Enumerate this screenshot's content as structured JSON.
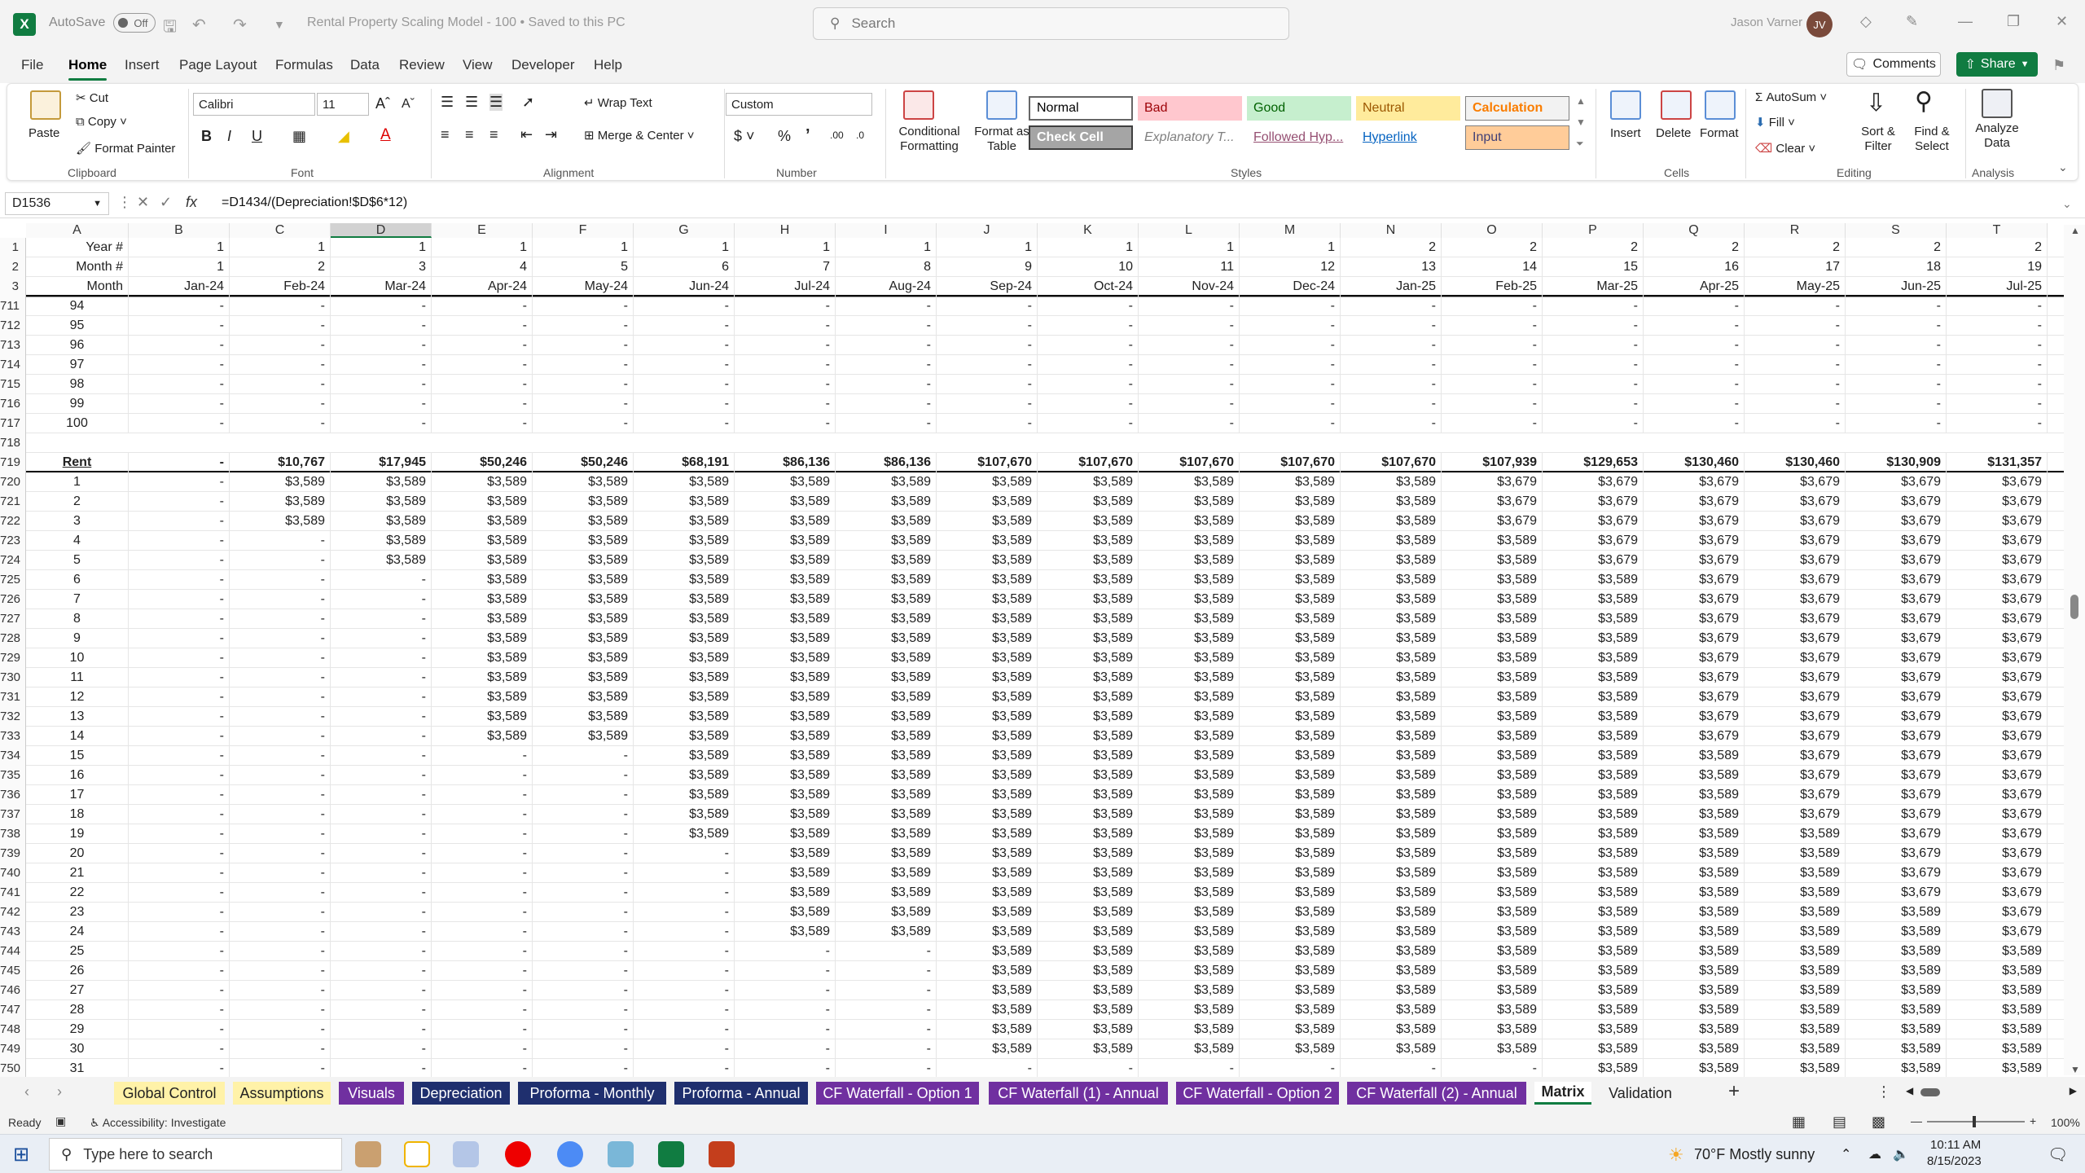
{
  "titlebar": {
    "autosave_label": "AutoSave",
    "autosave_state": "Off",
    "doc_title": "Rental Property Scaling Model - 100  •  Saved to this PC",
    "search_placeholder": "Search",
    "user_name": "Jason Varner",
    "user_initials": "JV"
  },
  "menu": [
    "File",
    "Home",
    "Insert",
    "Page Layout",
    "Formulas",
    "Data",
    "Review",
    "View",
    "Developer",
    "Help"
  ],
  "actions": {
    "comments": "Comments",
    "share": "Share"
  },
  "ribbon": {
    "clipboard": {
      "paste": "Paste",
      "cut": "Cut",
      "copy": "Copy",
      "format_painter": "Format Painter",
      "label": "Clipboard"
    },
    "font": {
      "name": "Calibri",
      "size": "11",
      "label": "Font"
    },
    "alignment": {
      "wrap": "Wrap Text",
      "merge": "Merge & Center",
      "label": "Alignment"
    },
    "number": {
      "format": "Custom",
      "label": "Number"
    },
    "styles": {
      "conditional": "Conditional Formatting",
      "format_table": "Format as Table",
      "label": "Styles",
      "cells": [
        "Normal",
        "Bad",
        "Good",
        "Neutral",
        "Calculation",
        "Check Cell",
        "Explanatory T...",
        "Followed Hyp...",
        "Hyperlink",
        "Input"
      ]
    },
    "cells": {
      "insert": "Insert",
      "delete": "Delete",
      "format": "Format",
      "label": "Cells"
    },
    "editing": {
      "autosum": "AutoSum",
      "fill": "Fill",
      "clear": "Clear",
      "sort": "Sort & Filter",
      "find": "Find & Select",
      "label": "Editing"
    },
    "analysis": {
      "analyze": "Analyze Data",
      "label": "Analysis"
    }
  },
  "formula_bar": {
    "name_box": "D1536",
    "formula": "=D1434/(Depreciation!$D$6*12)"
  },
  "columns": [
    "A",
    "B",
    "C",
    "D",
    "E",
    "F",
    "G",
    "H",
    "I",
    "J",
    "K",
    "L",
    "M",
    "N",
    "O",
    "P",
    "Q",
    "R",
    "S",
    "T"
  ],
  "header_rows": [
    {
      "num": "1",
      "cells": [
        "Year #",
        "1",
        "1",
        "1",
        "1",
        "1",
        "1",
        "1",
        "1",
        "1",
        "1",
        "1",
        "1",
        "2",
        "2",
        "2",
        "2",
        "2",
        "2",
        "2"
      ]
    },
    {
      "num": "2",
      "cells": [
        "Month #",
        "1",
        "2",
        "3",
        "4",
        "5",
        "6",
        "7",
        "8",
        "9",
        "10",
        "11",
        "12",
        "13",
        "14",
        "15",
        "16",
        "17",
        "18",
        "19"
      ]
    },
    {
      "num": "3",
      "cells": [
        "Month",
        "Jan-24",
        "Feb-24",
        "Mar-24",
        "Apr-24",
        "May-24",
        "Jun-24",
        "Jul-24",
        "Aug-24",
        "Sep-24",
        "Oct-24",
        "Nov-24",
        "Dec-24",
        "Jan-25",
        "Feb-25",
        "Mar-25",
        "Apr-25",
        "May-25",
        "Jun-25",
        "Jul-25"
      ]
    }
  ],
  "dash_rows": [
    {
      "num": "711",
      "a": "94"
    },
    {
      "num": "712",
      "a": "95"
    },
    {
      "num": "713",
      "a": "96"
    },
    {
      "num": "714",
      "a": "97"
    },
    {
      "num": "715",
      "a": "98"
    },
    {
      "num": "716",
      "a": "99"
    },
    {
      "num": "717",
      "a": "100"
    }
  ],
  "blank_row": "718",
  "rent_row": {
    "num": "719",
    "cells": [
      "Rent",
      "-",
      "$10,767",
      "$17,945",
      "$50,246",
      "$50,246",
      "$68,191",
      "$86,136",
      "$86,136",
      "$107,670",
      "$107,670",
      "$107,670",
      "$107,670",
      "$107,670",
      "$107,939",
      "$129,653",
      "$130,460",
      "$130,460",
      "$130,909",
      "$131,357"
    ]
  },
  "unit_rows": [
    {
      "num": "720",
      "cells": [
        "1",
        "-",
        "$3,589",
        "$3,589",
        "$3,589",
        "$3,589",
        "$3,589",
        "$3,589",
        "$3,589",
        "$3,589",
        "$3,589",
        "$3,589",
        "$3,589",
        "$3,589",
        "$3,679",
        "$3,679",
        "$3,679",
        "$3,679",
        "$3,679",
        "$3,679"
      ]
    },
    {
      "num": "721",
      "cells": [
        "2",
        "-",
        "$3,589",
        "$3,589",
        "$3,589",
        "$3,589",
        "$3,589",
        "$3,589",
        "$3,589",
        "$3,589",
        "$3,589",
        "$3,589",
        "$3,589",
        "$3,589",
        "$3,679",
        "$3,679",
        "$3,679",
        "$3,679",
        "$3,679",
        "$3,679"
      ]
    },
    {
      "num": "722",
      "cells": [
        "3",
        "-",
        "$3,589",
        "$3,589",
        "$3,589",
        "$3,589",
        "$3,589",
        "$3,589",
        "$3,589",
        "$3,589",
        "$3,589",
        "$3,589",
        "$3,589",
        "$3,589",
        "$3,679",
        "$3,679",
        "$3,679",
        "$3,679",
        "$3,679",
        "$3,679"
      ]
    },
    {
      "num": "723",
      "cells": [
        "4",
        "-",
        "-",
        "$3,589",
        "$3,589",
        "$3,589",
        "$3,589",
        "$3,589",
        "$3,589",
        "$3,589",
        "$3,589",
        "$3,589",
        "$3,589",
        "$3,589",
        "$3,589",
        "$3,679",
        "$3,679",
        "$3,679",
        "$3,679",
        "$3,679"
      ]
    },
    {
      "num": "724",
      "cells": [
        "5",
        "-",
        "-",
        "$3,589",
        "$3,589",
        "$3,589",
        "$3,589",
        "$3,589",
        "$3,589",
        "$3,589",
        "$3,589",
        "$3,589",
        "$3,589",
        "$3,589",
        "$3,589",
        "$3,679",
        "$3,679",
        "$3,679",
        "$3,679",
        "$3,679"
      ]
    },
    {
      "num": "725",
      "cells": [
        "6",
        "-",
        "-",
        "-",
        "$3,589",
        "$3,589",
        "$3,589",
        "$3,589",
        "$3,589",
        "$3,589",
        "$3,589",
        "$3,589",
        "$3,589",
        "$3,589",
        "$3,589",
        "$3,589",
        "$3,679",
        "$3,679",
        "$3,679",
        "$3,679"
      ]
    },
    {
      "num": "726",
      "cells": [
        "7",
        "-",
        "-",
        "-",
        "$3,589",
        "$3,589",
        "$3,589",
        "$3,589",
        "$3,589",
        "$3,589",
        "$3,589",
        "$3,589",
        "$3,589",
        "$3,589",
        "$3,589",
        "$3,589",
        "$3,679",
        "$3,679",
        "$3,679",
        "$3,679"
      ]
    },
    {
      "num": "727",
      "cells": [
        "8",
        "-",
        "-",
        "-",
        "$3,589",
        "$3,589",
        "$3,589",
        "$3,589",
        "$3,589",
        "$3,589",
        "$3,589",
        "$3,589",
        "$3,589",
        "$3,589",
        "$3,589",
        "$3,589",
        "$3,679",
        "$3,679",
        "$3,679",
        "$3,679"
      ]
    },
    {
      "num": "728",
      "cells": [
        "9",
        "-",
        "-",
        "-",
        "$3,589",
        "$3,589",
        "$3,589",
        "$3,589",
        "$3,589",
        "$3,589",
        "$3,589",
        "$3,589",
        "$3,589",
        "$3,589",
        "$3,589",
        "$3,589",
        "$3,679",
        "$3,679",
        "$3,679",
        "$3,679"
      ]
    },
    {
      "num": "729",
      "cells": [
        "10",
        "-",
        "-",
        "-",
        "$3,589",
        "$3,589",
        "$3,589",
        "$3,589",
        "$3,589",
        "$3,589",
        "$3,589",
        "$3,589",
        "$3,589",
        "$3,589",
        "$3,589",
        "$3,589",
        "$3,679",
        "$3,679",
        "$3,679",
        "$3,679"
      ]
    },
    {
      "num": "730",
      "cells": [
        "11",
        "-",
        "-",
        "-",
        "$3,589",
        "$3,589",
        "$3,589",
        "$3,589",
        "$3,589",
        "$3,589",
        "$3,589",
        "$3,589",
        "$3,589",
        "$3,589",
        "$3,589",
        "$3,589",
        "$3,679",
        "$3,679",
        "$3,679",
        "$3,679"
      ]
    },
    {
      "num": "731",
      "cells": [
        "12",
        "-",
        "-",
        "-",
        "$3,589",
        "$3,589",
        "$3,589",
        "$3,589",
        "$3,589",
        "$3,589",
        "$3,589",
        "$3,589",
        "$3,589",
        "$3,589",
        "$3,589",
        "$3,589",
        "$3,679",
        "$3,679",
        "$3,679",
        "$3,679"
      ]
    },
    {
      "num": "732",
      "cells": [
        "13",
        "-",
        "-",
        "-",
        "$3,589",
        "$3,589",
        "$3,589",
        "$3,589",
        "$3,589",
        "$3,589",
        "$3,589",
        "$3,589",
        "$3,589",
        "$3,589",
        "$3,589",
        "$3,589",
        "$3,679",
        "$3,679",
        "$3,679",
        "$3,679"
      ]
    },
    {
      "num": "733",
      "cells": [
        "14",
        "-",
        "-",
        "-",
        "$3,589",
        "$3,589",
        "$3,589",
        "$3,589",
        "$3,589",
        "$3,589",
        "$3,589",
        "$3,589",
        "$3,589",
        "$3,589",
        "$3,589",
        "$3,589",
        "$3,679",
        "$3,679",
        "$3,679",
        "$3,679"
      ]
    },
    {
      "num": "734",
      "cells": [
        "15",
        "-",
        "-",
        "-",
        "-",
        "-",
        "$3,589",
        "$3,589",
        "$3,589",
        "$3,589",
        "$3,589",
        "$3,589",
        "$3,589",
        "$3,589",
        "$3,589",
        "$3,589",
        "$3,589",
        "$3,679",
        "$3,679",
        "$3,679"
      ]
    },
    {
      "num": "735",
      "cells": [
        "16",
        "-",
        "-",
        "-",
        "-",
        "-",
        "$3,589",
        "$3,589",
        "$3,589",
        "$3,589",
        "$3,589",
        "$3,589",
        "$3,589",
        "$3,589",
        "$3,589",
        "$3,589",
        "$3,589",
        "$3,679",
        "$3,679",
        "$3,679"
      ]
    },
    {
      "num": "736",
      "cells": [
        "17",
        "-",
        "-",
        "-",
        "-",
        "-",
        "$3,589",
        "$3,589",
        "$3,589",
        "$3,589",
        "$3,589",
        "$3,589",
        "$3,589",
        "$3,589",
        "$3,589",
        "$3,589",
        "$3,589",
        "$3,679",
        "$3,679",
        "$3,679"
      ]
    },
    {
      "num": "737",
      "cells": [
        "18",
        "-",
        "-",
        "-",
        "-",
        "-",
        "$3,589",
        "$3,589",
        "$3,589",
        "$3,589",
        "$3,589",
        "$3,589",
        "$3,589",
        "$3,589",
        "$3,589",
        "$3,589",
        "$3,589",
        "$3,679",
        "$3,679",
        "$3,679"
      ]
    },
    {
      "num": "738",
      "cells": [
        "19",
        "-",
        "-",
        "-",
        "-",
        "-",
        "$3,589",
        "$3,589",
        "$3,589",
        "$3,589",
        "$3,589",
        "$3,589",
        "$3,589",
        "$3,589",
        "$3,589",
        "$3,589",
        "$3,589",
        "$3,589",
        "$3,679",
        "$3,679"
      ]
    },
    {
      "num": "739",
      "cells": [
        "20",
        "-",
        "-",
        "-",
        "-",
        "-",
        "-",
        "$3,589",
        "$3,589",
        "$3,589",
        "$3,589",
        "$3,589",
        "$3,589",
        "$3,589",
        "$3,589",
        "$3,589",
        "$3,589",
        "$3,589",
        "$3,679",
        "$3,679"
      ]
    },
    {
      "num": "740",
      "cells": [
        "21",
        "-",
        "-",
        "-",
        "-",
        "-",
        "-",
        "$3,589",
        "$3,589",
        "$3,589",
        "$3,589",
        "$3,589",
        "$3,589",
        "$3,589",
        "$3,589",
        "$3,589",
        "$3,589",
        "$3,589",
        "$3,679",
        "$3,679"
      ]
    },
    {
      "num": "741",
      "cells": [
        "22",
        "-",
        "-",
        "-",
        "-",
        "-",
        "-",
        "$3,589",
        "$3,589",
        "$3,589",
        "$3,589",
        "$3,589",
        "$3,589",
        "$3,589",
        "$3,589",
        "$3,589",
        "$3,589",
        "$3,589",
        "$3,679",
        "$3,679"
      ]
    },
    {
      "num": "742",
      "cells": [
        "23",
        "-",
        "-",
        "-",
        "-",
        "-",
        "-",
        "$3,589",
        "$3,589",
        "$3,589",
        "$3,589",
        "$3,589",
        "$3,589",
        "$3,589",
        "$3,589",
        "$3,589",
        "$3,589",
        "$3,589",
        "$3,589",
        "$3,679"
      ]
    },
    {
      "num": "743",
      "cells": [
        "24",
        "-",
        "-",
        "-",
        "-",
        "-",
        "-",
        "$3,589",
        "$3,589",
        "$3,589",
        "$3,589",
        "$3,589",
        "$3,589",
        "$3,589",
        "$3,589",
        "$3,589",
        "$3,589",
        "$3,589",
        "$3,589",
        "$3,679"
      ]
    },
    {
      "num": "744",
      "cells": [
        "25",
        "-",
        "-",
        "-",
        "-",
        "-",
        "-",
        "-",
        "-",
        "$3,589",
        "$3,589",
        "$3,589",
        "$3,589",
        "$3,589",
        "$3,589",
        "$3,589",
        "$3,589",
        "$3,589",
        "$3,589",
        "$3,589"
      ]
    },
    {
      "num": "745",
      "cells": [
        "26",
        "-",
        "-",
        "-",
        "-",
        "-",
        "-",
        "-",
        "-",
        "$3,589",
        "$3,589",
        "$3,589",
        "$3,589",
        "$3,589",
        "$3,589",
        "$3,589",
        "$3,589",
        "$3,589",
        "$3,589",
        "$3,589"
      ]
    },
    {
      "num": "746",
      "cells": [
        "27",
        "-",
        "-",
        "-",
        "-",
        "-",
        "-",
        "-",
        "-",
        "$3,589",
        "$3,589",
        "$3,589",
        "$3,589",
        "$3,589",
        "$3,589",
        "$3,589",
        "$3,589",
        "$3,589",
        "$3,589",
        "$3,589"
      ]
    },
    {
      "num": "747",
      "cells": [
        "28",
        "-",
        "-",
        "-",
        "-",
        "-",
        "-",
        "-",
        "-",
        "$3,589",
        "$3,589",
        "$3,589",
        "$3,589",
        "$3,589",
        "$3,589",
        "$3,589",
        "$3,589",
        "$3,589",
        "$3,589",
        "$3,589"
      ]
    },
    {
      "num": "748",
      "cells": [
        "29",
        "-",
        "-",
        "-",
        "-",
        "-",
        "-",
        "-",
        "-",
        "$3,589",
        "$3,589",
        "$3,589",
        "$3,589",
        "$3,589",
        "$3,589",
        "$3,589",
        "$3,589",
        "$3,589",
        "$3,589",
        "$3,589"
      ]
    },
    {
      "num": "749",
      "cells": [
        "30",
        "-",
        "-",
        "-",
        "-",
        "-",
        "-",
        "-",
        "-",
        "$3,589",
        "$3,589",
        "$3,589",
        "$3,589",
        "$3,589",
        "$3,589",
        "$3,589",
        "$3,589",
        "$3,589",
        "$3,589",
        "$3,589"
      ]
    },
    {
      "num": "750",
      "cells": [
        "31",
        "-",
        "-",
        "-",
        "-",
        "-",
        "-",
        "-",
        "-",
        "-",
        "-",
        "-",
        "-",
        "-",
        "-",
        "$3,589",
        "$3,589",
        "$3,589",
        "$3,589",
        "$3,589"
      ]
    }
  ],
  "sheet_tabs": [
    {
      "label": "Global Control",
      "bg": "#fff2a8",
      "fg": "#222"
    },
    {
      "label": "Assumptions",
      "bg": "#fff2a8",
      "fg": "#222"
    },
    {
      "label": "Visuals",
      "bg": "#7030a0",
      "fg": "#ffffff"
    },
    {
      "label": "Depreciation",
      "bg": "#1f2f6e",
      "fg": "#ffffff"
    },
    {
      "label": "Proforma - Monthly",
      "bg": "#1f2f6e",
      "fg": "#ffffff"
    },
    {
      "label": "Proforma - Annual",
      "bg": "#1f2f6e",
      "fg": "#ffffff"
    },
    {
      "label": "CF Waterfall - Option 1",
      "bg": "#7030a0",
      "fg": "#ffffff"
    },
    {
      "label": "CF Waterfall (1) - Annual",
      "bg": "#7030a0",
      "fg": "#ffffff"
    },
    {
      "label": "CF Waterfall - Option 2",
      "bg": "#7030a0",
      "fg": "#ffffff"
    },
    {
      "label": "CF Waterfall (2) - Annual",
      "bg": "#7030a0",
      "fg": "#ffffff"
    },
    {
      "label": "Matrix",
      "bg": "#ffffff",
      "fg": "#107c41"
    },
    {
      "label": "Validation",
      "bg": "#f3f3f3",
      "fg": "#222"
    }
  ],
  "status": {
    "ready": "Ready",
    "accessibility": "Accessibility: Investigate",
    "zoom": "100%"
  },
  "taskbar": {
    "search_placeholder": "Type here to search",
    "weather": "70°F  Mostly sunny",
    "time": "10:11 AM",
    "date": "8/15/2023"
  },
  "colors": {
    "excel_green": "#107c41",
    "title_bg": "#f3f3f3"
  }
}
